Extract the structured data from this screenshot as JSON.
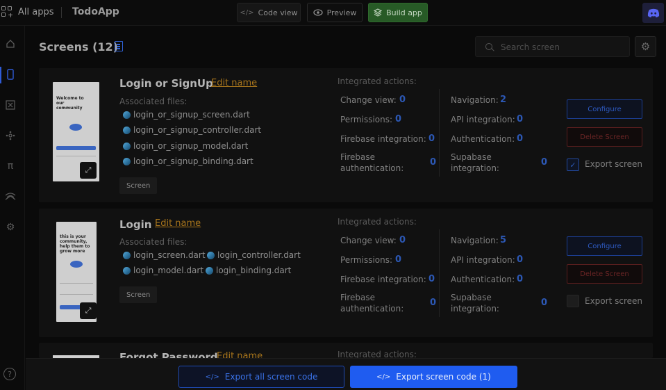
{
  "topbar": {
    "all_apps": "All apps",
    "app_title": "TodoApp",
    "code_view": "Code view",
    "preview": "Preview",
    "build_app": "Build app"
  },
  "header": {
    "title": "Screens (12)",
    "search_placeholder": "Search screen"
  },
  "screens": [
    {
      "name": "Login or SignUp",
      "edit_label": "Edit name",
      "assoc_label": "Associated files:",
      "thumb_text": "Welcome to our community",
      "files": [
        "login_or_signup_screen.dart",
        "login_or_signup_controller.dart",
        "login_or_signup_model.dart",
        "login_or_signup_binding.dart"
      ],
      "tag": "Screen",
      "integrated_label": "Integrated actions:",
      "actions": {
        "change_view": {
          "label": "Change view:",
          "value": "0"
        },
        "permissions": {
          "label": "Permissions:",
          "value": "0"
        },
        "firebase_integration": {
          "label": "Firebase integration:",
          "value": "0"
        },
        "firebase_auth": {
          "label": "Firebase authentication:",
          "value": "0"
        },
        "navigation": {
          "label": "Navigation:",
          "value": "2"
        },
        "api_integration": {
          "label": "API integration:",
          "value": "0"
        },
        "authentication": {
          "label": "Authentication:",
          "value": "0"
        },
        "supabase_integration": {
          "label": "Supabase integration:",
          "value": "0"
        }
      },
      "configure": "Configure",
      "delete": "Delete Screen",
      "export_label": "Export screen",
      "export_checked": true
    },
    {
      "name": "Login",
      "edit_label": "Edit name",
      "assoc_label": "Associated files:",
      "thumb_text": "this is your community, help them to grow more",
      "files": [
        "login_screen.dart",
        "login_controller.dart",
        "login_model.dart",
        "login_binding.dart"
      ],
      "tag": "Screen",
      "integrated_label": "Integrated actions:",
      "actions": {
        "change_view": {
          "label": "Change view:",
          "value": "0"
        },
        "permissions": {
          "label": "Permissions:",
          "value": "0"
        },
        "firebase_integration": {
          "label": "Firebase integration:",
          "value": "0"
        },
        "firebase_auth": {
          "label": "Firebase authentication:",
          "value": "0"
        },
        "navigation": {
          "label": "Navigation:",
          "value": "5"
        },
        "api_integration": {
          "label": "API integration:",
          "value": "0"
        },
        "authentication": {
          "label": "Authentication:",
          "value": "0"
        },
        "supabase_integration": {
          "label": "Supabase integration:",
          "value": "0"
        }
      },
      "configure": "Configure",
      "delete": "Delete Screen",
      "export_label": "Export screen",
      "export_checked": false
    },
    {
      "name": "Forgot Password",
      "edit_label": "Edit name",
      "integrated_label": "Integrated actions:"
    }
  ],
  "footer": {
    "export_all": "Export all screen code",
    "export_selected": "Export screen code (1)"
  },
  "colors": {
    "accent_blue": "#1f5cf0",
    "build_green": "#275a26",
    "edit_orange": "#a8751c",
    "danger_red": "#6b2525"
  }
}
